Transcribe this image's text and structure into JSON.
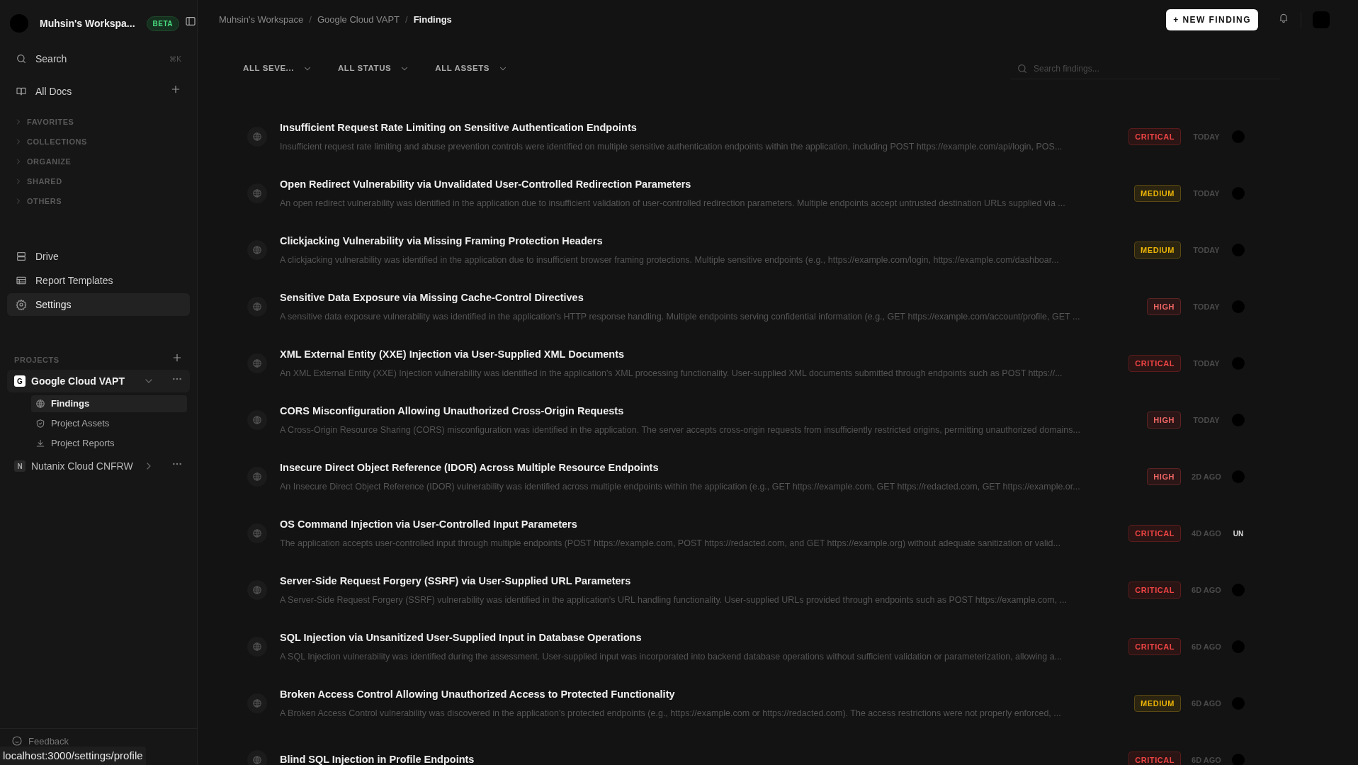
{
  "sidebar": {
    "workspace": "Muhsin's Workspa...",
    "badge": "BETA",
    "search": {
      "label": "Search",
      "shortcut": "⌘K"
    },
    "all_docs": "All Docs",
    "sections": [
      {
        "label": "FAVORITES",
        "expanded": false
      },
      {
        "label": "COLLECTIONS",
        "expanded": false
      },
      {
        "label": "ORGANIZE",
        "expanded": false
      },
      {
        "label": "SHARED",
        "expanded": false
      },
      {
        "label": "OTHERS",
        "expanded": false
      }
    ],
    "nav": [
      {
        "kind": "drive",
        "label": "Drive",
        "selected": false
      },
      {
        "kind": "templates",
        "label": "Report Templates",
        "selected": false
      },
      {
        "kind": "settings",
        "label": "Settings",
        "selected": true
      }
    ],
    "projects_label": "PROJECTS",
    "projects": [
      {
        "initial": "G",
        "name": "Google Cloud VAPT",
        "expanded": true,
        "children": [
          {
            "kind": "findings",
            "label": "Findings",
            "selected": true
          },
          {
            "kind": "assets",
            "label": "Project Assets",
            "selected": false
          },
          {
            "kind": "reports",
            "label": "Project Reports",
            "selected": false
          }
        ]
      },
      {
        "initial": "N",
        "name": "Nutanix Cloud CNFRW",
        "expanded": false
      }
    ],
    "feedback": "Feedback"
  },
  "breadcrumb": [
    "Muhsin's Workspace",
    "Google Cloud VAPT",
    "Findings"
  ],
  "breadcrumb_separators": [
    "/",
    "/"
  ],
  "new_button": "+ NEW FINDING",
  "filters": [
    "ALL SEVE...",
    "ALL STATUS",
    "ALL ASSETS"
  ],
  "search": {
    "placeholder": "Search findings..."
  },
  "findings": [
    {
      "title": "Insufficient Request Rate Limiting on Sensitive Authentication Endpoints",
      "description": "Insufficient request rate limiting and abuse prevention controls were identified on multiple sensitive authentication endpoints within the application, including POST https://example.com/api/login, POS...",
      "severity": "CRITICAL",
      "time": "TODAY",
      "assignee": {
        "kind": "avatar"
      }
    },
    {
      "title": "Open Redirect Vulnerability via Unvalidated User-Controlled Redirection Parameters",
      "description": "An open redirect vulnerability was identified in the application due to insufficient validation of user-controlled redirection parameters. Multiple endpoints accept untrusted destination URLs supplied via ...",
      "severity": "MEDIUM",
      "time": "TODAY",
      "assignee": {
        "kind": "avatar"
      }
    },
    {
      "title": "Clickjacking Vulnerability via Missing Framing Protection Headers",
      "description": "A clickjacking vulnerability was identified in the application due to insufficient browser framing protections. Multiple sensitive endpoints (e.g., https://example.com/login, https://example.com/dashboar...",
      "severity": "MEDIUM",
      "time": "TODAY",
      "assignee": {
        "kind": "avatar"
      }
    },
    {
      "title": "Sensitive Data Exposure via Missing Cache-Control Directives",
      "description": "A sensitive data exposure vulnerability was identified in the application's HTTP response handling. Multiple endpoints serving confidential information (e.g., GET https://example.com/account/profile, GET ...",
      "severity": "HIGH",
      "time": "TODAY",
      "assignee": {
        "kind": "avatar"
      }
    },
    {
      "title": "XML External Entity (XXE) Injection via User-Supplied XML Documents",
      "description": "An XML External Entity (XXE) Injection vulnerability was identified in the application's XML processing functionality. User-supplied XML documents submitted through endpoints such as POST https://...",
      "severity": "CRITICAL",
      "time": "TODAY",
      "assignee": {
        "kind": "avatar"
      }
    },
    {
      "title": "CORS Misconfiguration Allowing Unauthorized Cross-Origin Requests",
      "description": "A Cross-Origin Resource Sharing (CORS) misconfiguration was identified in the application. The server accepts cross-origin requests from insufficiently restricted origins, permitting unauthorized domains...",
      "severity": "HIGH",
      "time": "TODAY",
      "assignee": {
        "kind": "avatar"
      }
    },
    {
      "title": "Insecure Direct Object Reference (IDOR) Across Multiple Resource Endpoints",
      "description": "An Insecure Direct Object Reference (IDOR) vulnerability was identified across multiple endpoints within the application (e.g., GET https://example.com, GET https://redacted.com, GET https://example.or...",
      "severity": "HIGH",
      "time": "2D AGO",
      "assignee": {
        "kind": "avatar"
      }
    },
    {
      "title": "OS Command Injection via User-Controlled Input Parameters",
      "description": "The application accepts user-controlled input through multiple endpoints (POST https://example.com, POST https://redacted.com, and GET https://example.org) without adequate sanitization or valid...",
      "severity": "CRITICAL",
      "time": "4D AGO",
      "assignee": {
        "kind": "initials",
        "text": "UN"
      }
    },
    {
      "title": "Server-Side Request Forgery (SSRF) via User-Supplied URL Parameters",
      "description": "A Server-Side Request Forgery (SSRF) vulnerability was identified in the application's URL handling functionality. User-supplied URLs provided through endpoints such as POST https://example.com, ...",
      "severity": "CRITICAL",
      "time": "6D AGO",
      "assignee": {
        "kind": "avatar"
      }
    },
    {
      "title": "SQL Injection via Unsanitized User-Supplied Input in Database Operations",
      "description": "A SQL Injection vulnerability was identified during the assessment. User-supplied input was incorporated into backend database operations without sufficient validation or parameterization, allowing a...",
      "severity": "CRITICAL",
      "time": "6D AGO",
      "assignee": {
        "kind": "avatar"
      }
    },
    {
      "title": "Broken Access Control Allowing Unauthorized Access to Protected Functionality",
      "description": "A Broken Access Control vulnerability was discovered in the application's protected endpoints (e.g., https://example.com or https://redacted.com). The access restrictions were not properly enforced, ...",
      "severity": "MEDIUM",
      "time": "6D AGO",
      "assignee": {
        "kind": "avatar"
      }
    },
    {
      "title": "Blind SQL Injection in Profile Endpoints",
      "severity": "CRITICAL",
      "time": "6D AGO",
      "assignee": {
        "kind": "avatar"
      }
    }
  ],
  "status_url": "localhost:3000/settings/profile"
}
